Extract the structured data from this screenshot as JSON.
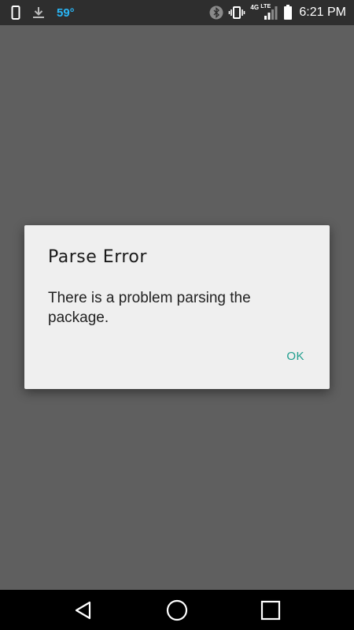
{
  "status_bar": {
    "icons_left": [
      "phone-icon",
      "download-icon"
    ],
    "temperature": "59°",
    "icons_right": [
      "bluetooth-icon",
      "vibrate-icon",
      "4g-lte-signal-icon",
      "battery-icon"
    ],
    "network_label": "4G",
    "network_sub": "LTE",
    "time": "6:21 PM"
  },
  "dialog": {
    "title": "Parse Error",
    "message": "There is a problem parsing the package.",
    "ok_label": "OK",
    "ok_color": "#1f9e8e"
  },
  "nav_bar": {
    "buttons": [
      "back-icon",
      "home-icon",
      "recents-icon"
    ]
  }
}
